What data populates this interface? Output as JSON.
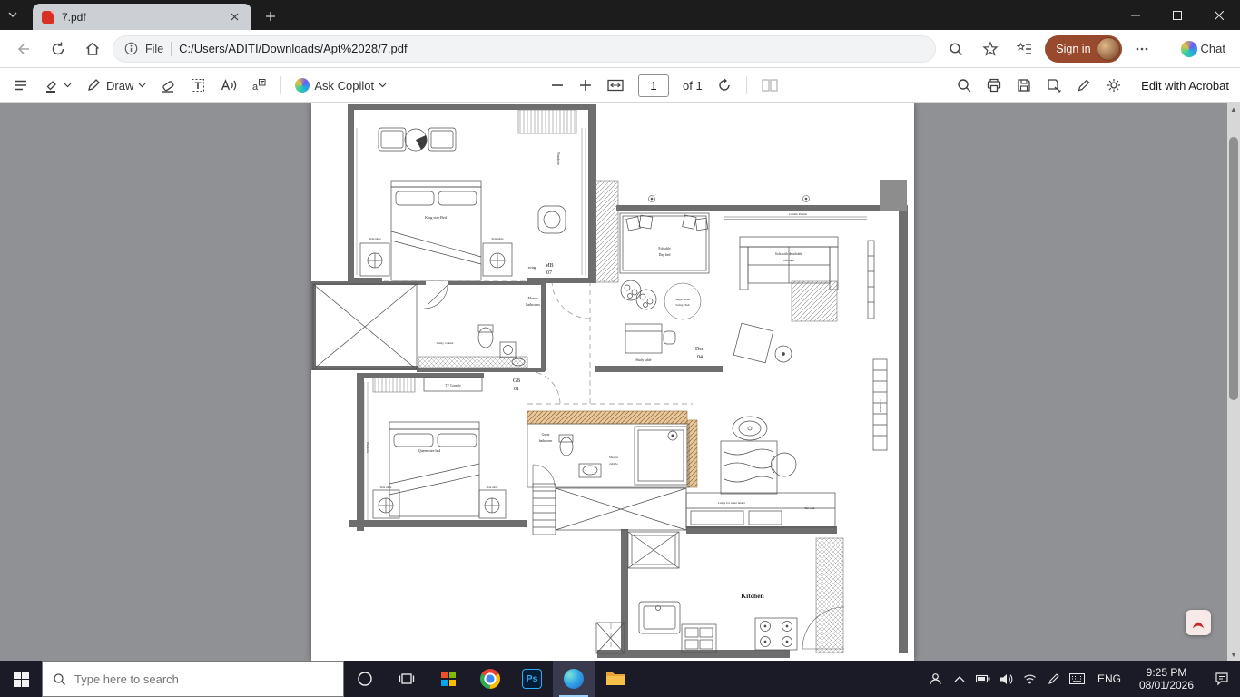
{
  "browser": {
    "tab_title": "7.pdf",
    "address": {
      "scheme": "File",
      "url": "C:/Users/ADITI/Downloads/Apt%2028/7.pdf"
    },
    "sign_in_label": "Sign in",
    "chat_label": "Chat"
  },
  "pdf_toolbar": {
    "draw_label": "Draw",
    "ask_copilot_label": "Ask Copilot",
    "page_value": "1",
    "page_count_label": "of 1",
    "edit_acrobat_label": "Edit with Acrobat"
  },
  "plan": {
    "mb_line1": "MB",
    "mb_line2": "07",
    "den_line1": "Den",
    "den_line2": "04",
    "gb_line1": "GB",
    "gb_line2": "01",
    "kitchen": "Kitchen",
    "master_bath_line1": "Master",
    "master_bath_line2": "bathroom",
    "guest_bath_line1": "Guest",
    "guest_bath_line2": "bathroom",
    "king_bed": "King size Bed",
    "queen_bed": "Queen size bed",
    "side_table": "Side table",
    "wardrobe": "Wardrobe",
    "swing": "swing",
    "curtain_pelmet": "Curtain Pelmet",
    "day_bed_line1": "Foldable",
    "day_bed_line2": "Day bed",
    "sofa_line1": "Sofa with detachable",
    "sofa_line2": "ottoman",
    "swing_chair_line1": "Single seater",
    "swing_chair_line2": "Swing chair",
    "study_table": "Study table",
    "tv_console": "TV Console",
    "shower_line1": "Shower",
    "shower_line2": "cubicle",
    "vanity": "Vanity counter",
    "water_heater": "Ledge for water heater",
    "bar_unit": "Bar unit"
  },
  "taskbar": {
    "search_placeholder": "Type here to search",
    "photoshop_glyph": "Ps",
    "language": "ENG",
    "time": "9:25 PM",
    "date": "08/01/2026"
  },
  "colors": {
    "sign_in_button": "#9a4a2c",
    "content_background": "#8f9194",
    "taskbar_background": "#1b1b27",
    "pdf_red": "#d93025",
    "active_tab": "#ccd0d5"
  }
}
